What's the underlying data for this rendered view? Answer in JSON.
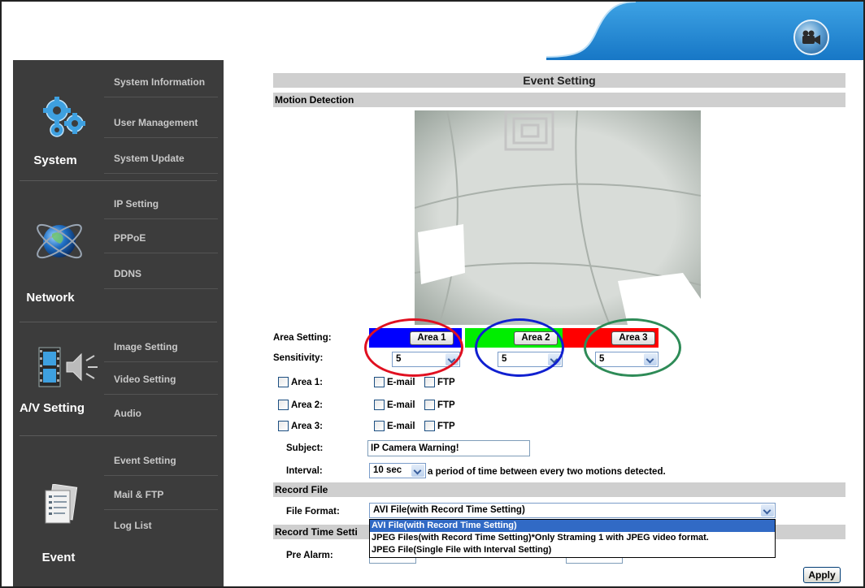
{
  "sidebar": {
    "sections": [
      {
        "label": "System",
        "icon": "gears-icon",
        "items": [
          "System Information",
          "User Management",
          "System Update"
        ]
      },
      {
        "label": "Network",
        "icon": "globe-icon",
        "items": [
          "IP Setting",
          "PPPoE",
          "DDNS"
        ]
      },
      {
        "label": "A/V Setting",
        "icon": "film-speaker-icon",
        "items": [
          "Image Setting",
          "Video Setting",
          "Audio"
        ]
      },
      {
        "label": "Event",
        "icon": "document-icon",
        "items": [
          "Event Setting",
          "Mail & FTP",
          "Log List"
        ]
      }
    ]
  },
  "page": {
    "title": "Event Setting",
    "motion_detection": "Motion Detection",
    "area_setting_label": "Area Setting:",
    "sensitivity_label": "Sensitivity:",
    "areas": [
      {
        "label": "Area 1",
        "color": "#0000ff",
        "sensitivity": "5"
      },
      {
        "label": "Area 2",
        "color": "#00ee00",
        "sensitivity": "5"
      },
      {
        "label": "Area 3",
        "color": "#ff0000",
        "sensitivity": "5"
      }
    ],
    "ring_colors": [
      "#e01020",
      "#1020d0",
      "#2e8b57"
    ],
    "area_rows": [
      {
        "label": "Area 1:"
      },
      {
        "label": "Area 2:"
      },
      {
        "label": "Area 3:"
      }
    ],
    "email_label": "E-mail",
    "ftp_label": "FTP",
    "subject_label": "Subject:",
    "subject_value": "IP Camera Warning!",
    "interval_label": "Interval:",
    "interval_value": "10 sec",
    "interval_note": "a period of time between every two motions detected.",
    "record_file": "Record File",
    "file_format_label": "File Format:",
    "file_format_value": "AVI File(with Record Time Setting)",
    "file_format_options": [
      "AVI File(with Record Time Setting)",
      "JPEG Files(with Record Time Setting)*Only Straming 1 with JPEG video format.",
      "JPEG File(Single File with Interval Setting)"
    ],
    "record_time_label": "Record Time Setti",
    "pre_alarm_label": "Pre Alarm:",
    "apply_label": "Apply"
  },
  "colors": {
    "sidebar_bg": "#3c3c3c",
    "header_accent": "#2a8fd6",
    "section_bar": "#cfcfcf"
  }
}
